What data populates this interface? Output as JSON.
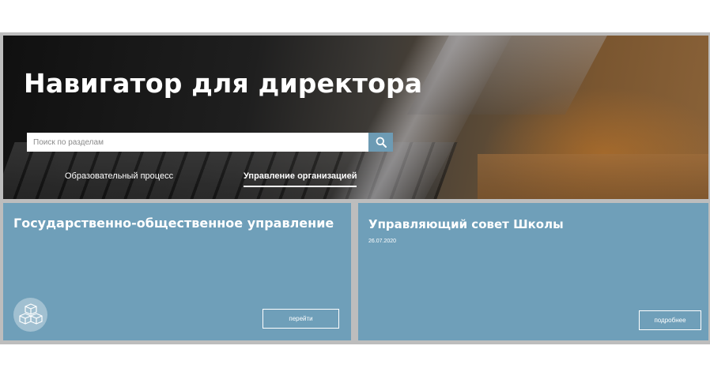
{
  "hero": {
    "title": "Навигатор для директора",
    "search": {
      "placeholder": "Поиск по разделам",
      "value": ""
    },
    "tabs": [
      {
        "label": "Образовательный процесс",
        "active": false
      },
      {
        "label": "Управление организацией",
        "active": true
      }
    ]
  },
  "cards": [
    {
      "title": "Государственно-общественное управление",
      "button_label": "перейти",
      "icon": "blocks-icon"
    },
    {
      "title": "Управляющий совет Школы",
      "date": "26.07.2020",
      "button_label": "подробнее"
    }
  ],
  "colors": {
    "card_background": "#6f9fb9",
    "search_button": "#6d9bb4",
    "frame": "#bdbdbd"
  }
}
